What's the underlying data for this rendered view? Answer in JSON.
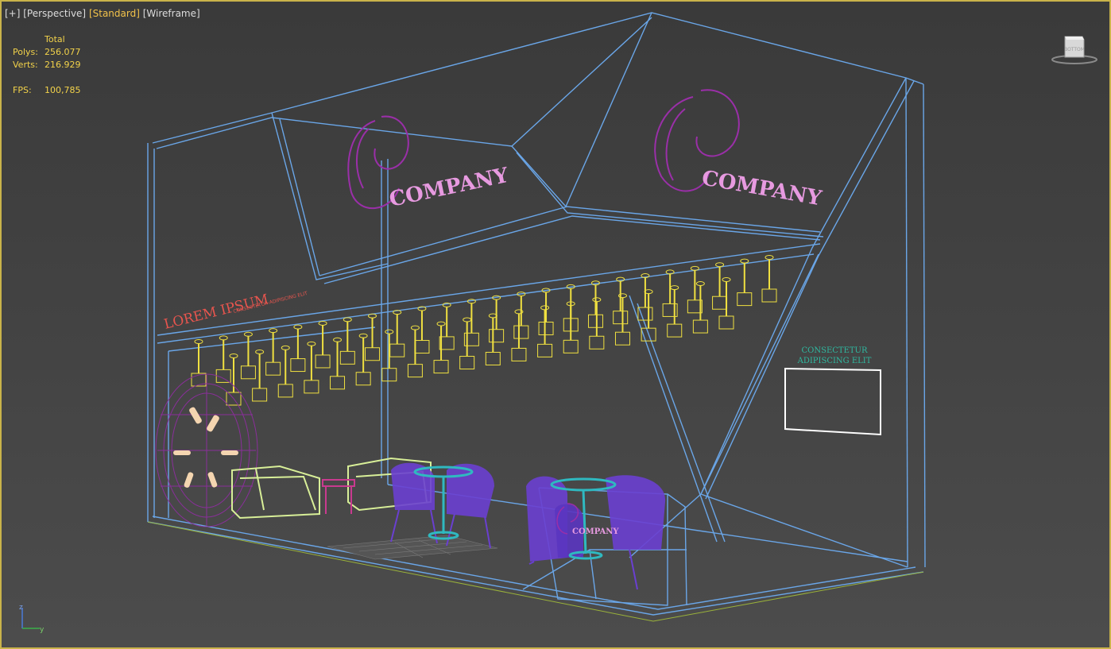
{
  "viewport": {
    "labels": {
      "plus": "[+]",
      "view": "[Perspective]",
      "shading": "[Standard]",
      "mode": "[Wireframe]"
    },
    "stats": {
      "header": "Total",
      "polys_label": "Polys:",
      "polys_value": "256.077",
      "verts_label": "Verts:",
      "verts_value": "216.929",
      "fps_label": "FPS:",
      "fps_value": "100,785"
    },
    "scene_text": {
      "company_1": "COMPANY",
      "company_2": "COMPANY",
      "company_3": "COMPANY",
      "lorem": "LOREM IPSUM",
      "lorem_sub": "CONSECTETUR ADIPISCING ELIT",
      "panel_line1": "CONSECTETUR",
      "panel_line2": "ADIPISCING ELIT"
    },
    "axis": {
      "z": "z",
      "y": "y"
    }
  },
  "colors": {
    "viewport_border": "#c9b34a",
    "wire_blue": "#6aa6e8",
    "lamp_yellow": "#f0e040",
    "logo_purple": "#9a2fa8",
    "chair_violet": "#6a3fd0",
    "sofa_green": "#d8ef98",
    "table_teal": "#2fb9c0",
    "floor_line": "#9ab23a",
    "active_label": "#f2c24a"
  }
}
